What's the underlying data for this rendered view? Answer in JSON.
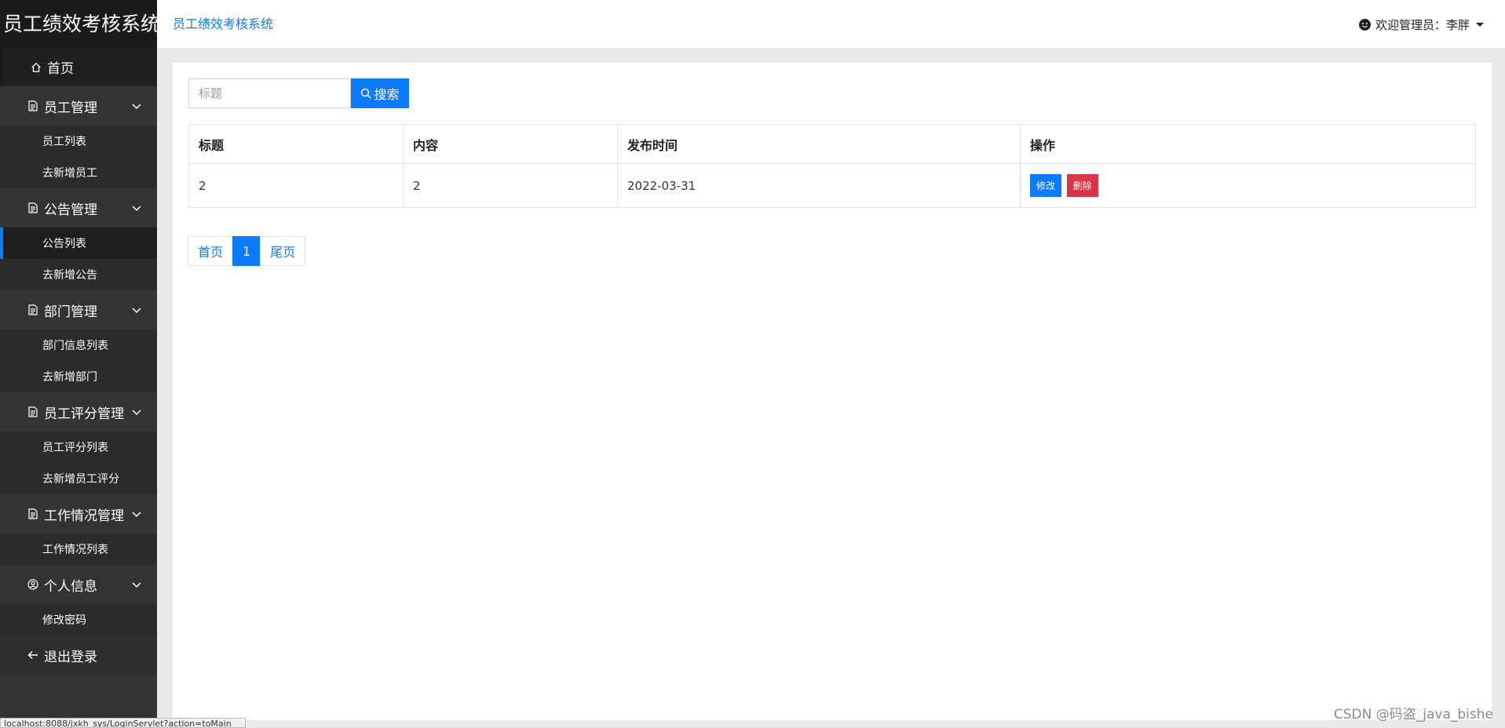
{
  "sidebar": {
    "brand": "员工绩效考核系统",
    "home": "首页",
    "groups": [
      {
        "label": "员工管理",
        "items": [
          "员工列表",
          "去新增员工"
        ]
      },
      {
        "label": "公告管理",
        "items": [
          "公告列表",
          "去新增公告"
        ]
      },
      {
        "label": "部门管理",
        "items": [
          "部门信息列表",
          "去新增部门"
        ]
      },
      {
        "label": "员工评分管理",
        "items": [
          "员工评分列表",
          "去新增员工评分"
        ]
      },
      {
        "label": "工作情况管理",
        "items": [
          "工作情况列表"
        ]
      },
      {
        "label": "个人信息",
        "items": [
          "修改密码"
        ]
      }
    ],
    "active_item": "公告列表",
    "logout": "退出登录"
  },
  "header": {
    "breadcrumb": "员工绩效考核系统",
    "welcome": "欢迎管理员：李胖"
  },
  "search": {
    "placeholder": "标题",
    "button": "搜索"
  },
  "table": {
    "columns": [
      "标题",
      "内容",
      "发布时间",
      "操作"
    ],
    "rows": [
      {
        "title": "2",
        "content": "2",
        "date": "2022-03-31",
        "edit": "修改",
        "delete": "删除"
      }
    ]
  },
  "pagination": {
    "first": "首页",
    "current": "1",
    "last": "尾页"
  },
  "statusbar": "localhost:8088/jxkh_sys/LoginServlet?action=toMain",
  "watermark": "CSDN @码盗_java_bishe",
  "colors": {
    "accent": "#0d7bff",
    "danger": "#dc3545",
    "sidebar": "#333333"
  }
}
